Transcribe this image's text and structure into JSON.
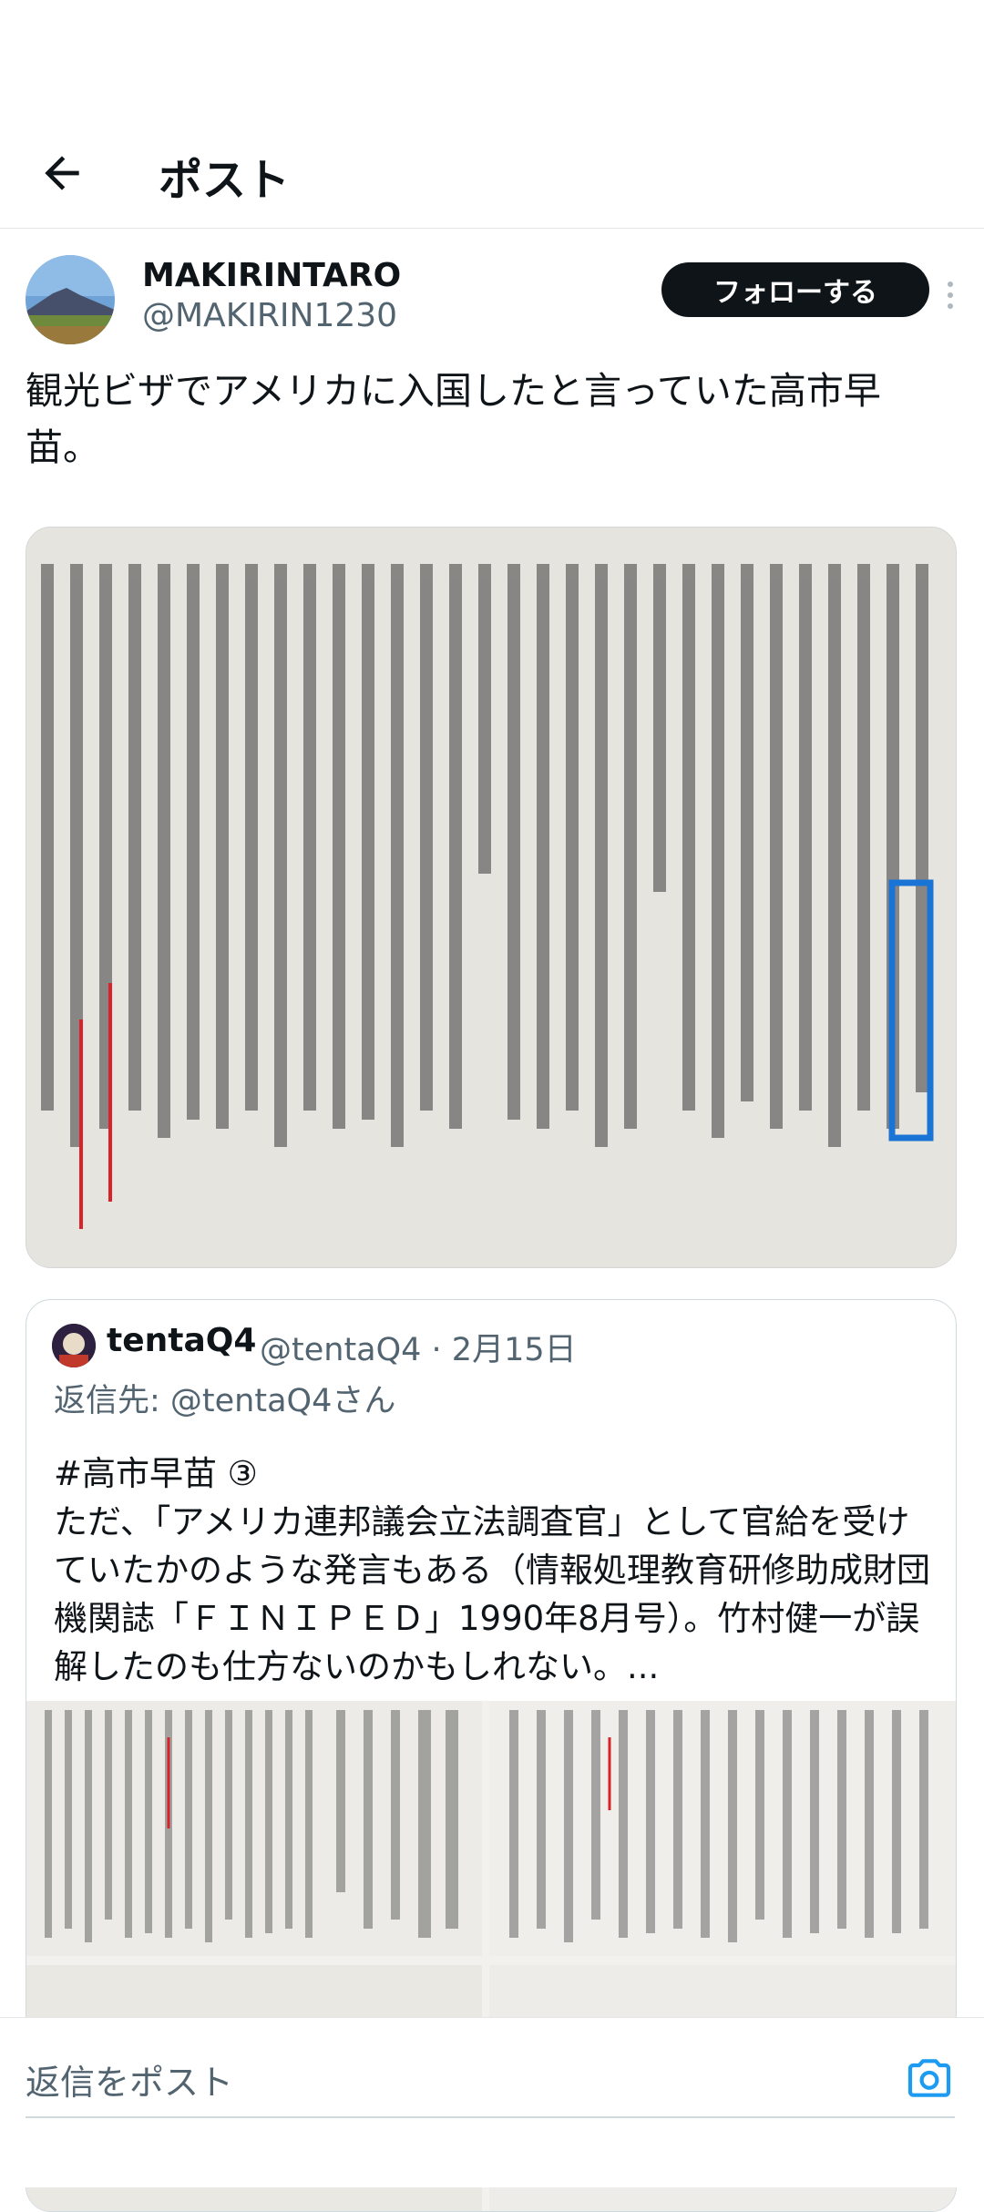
{
  "header": {
    "title": "ポスト"
  },
  "post": {
    "display_name": "MAKIRINTARO",
    "handle": "@MAKIRIN1230",
    "follow_label": "フォローする",
    "text": "観光ビザでアメリカに入国したと言っていた高市早苗。"
  },
  "quoted": {
    "name": "tentaQ4",
    "handle_date": "@tentaQ4 · 2月15日",
    "reply_to": "返信先: @tentaQ4さん",
    "text": "#高市早苗 ③\nただ、「アメリカ連邦議会立法調査官」として官給を受けていたかのような発言もある（情報処理教育研修助成財団機関誌「ＦＩＮＩＰＥＤ」1990年8月号）。竹村健一が誤解したのも仕方ないのかもしれない。..."
  },
  "reply_bar": {
    "placeholder": "返信をポスト"
  },
  "icons": {
    "back": "back-arrow-icon",
    "more": "more-vertical-icon",
    "camera": "camera-icon"
  },
  "colors": {
    "accent": "#1d9bf0",
    "text_secondary": "#536471",
    "follow_bg": "#0f1419",
    "highlight_box": "#1a74d6",
    "underline_red": "#d8232a"
  }
}
